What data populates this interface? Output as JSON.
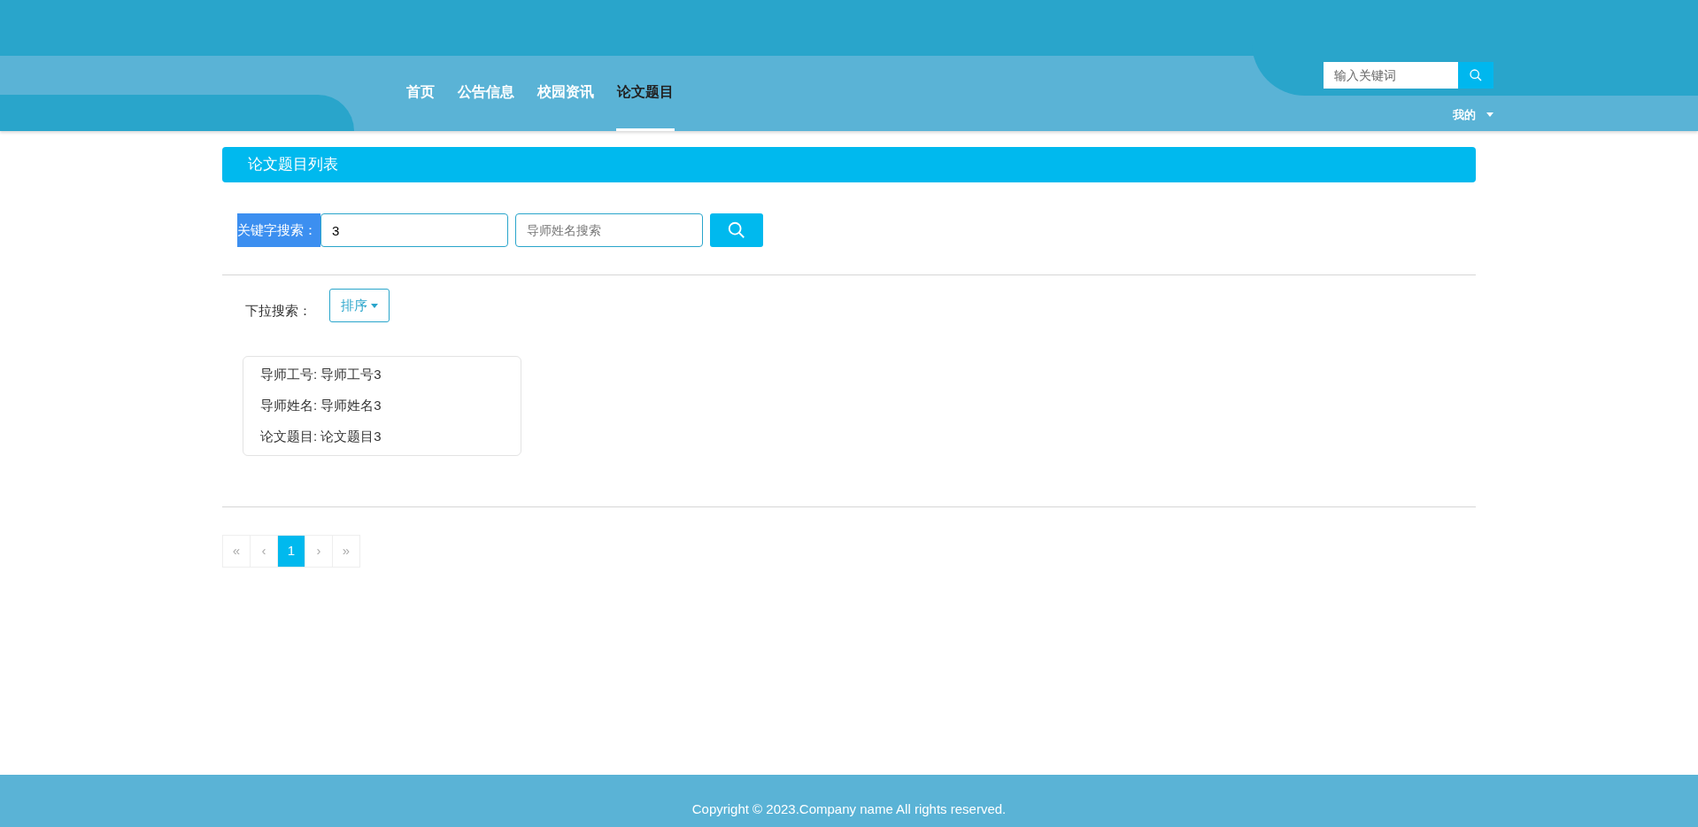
{
  "nav": {
    "items": [
      {
        "label": "首页",
        "selected": false
      },
      {
        "label": "公告信息",
        "selected": false
      },
      {
        "label": "校园资讯",
        "selected": false
      },
      {
        "label": "论文题目",
        "selected": true
      }
    ],
    "search": {
      "placeholder": "输入关键词"
    },
    "user_menu": "我的"
  },
  "panel_title": "论文题目列表",
  "search": {
    "label": "关键字搜索：",
    "label_highlighted": true,
    "keyword_value": "3",
    "name_placeholder": "导师姓名搜索"
  },
  "dropdown": {
    "label": "下拉搜索：",
    "button": "排序"
  },
  "cards": [
    {
      "fields": [
        {
          "label": "导师工号:",
          "value": "导师工号3"
        },
        {
          "label": "导师姓名:",
          "value": "导师姓名3"
        },
        {
          "label": "论文题目:",
          "value": "论文题目3"
        }
      ]
    }
  ],
  "pagination": [
    {
      "label": "«",
      "selected": false
    },
    {
      "label": "‹",
      "selected": false
    },
    {
      "label": "1",
      "selected": true
    },
    {
      "label": "›",
      "selected": false
    },
    {
      "label": "»",
      "selected": false
    }
  ],
  "footer": "Copyright © 2023.Company name All rights reserved."
}
